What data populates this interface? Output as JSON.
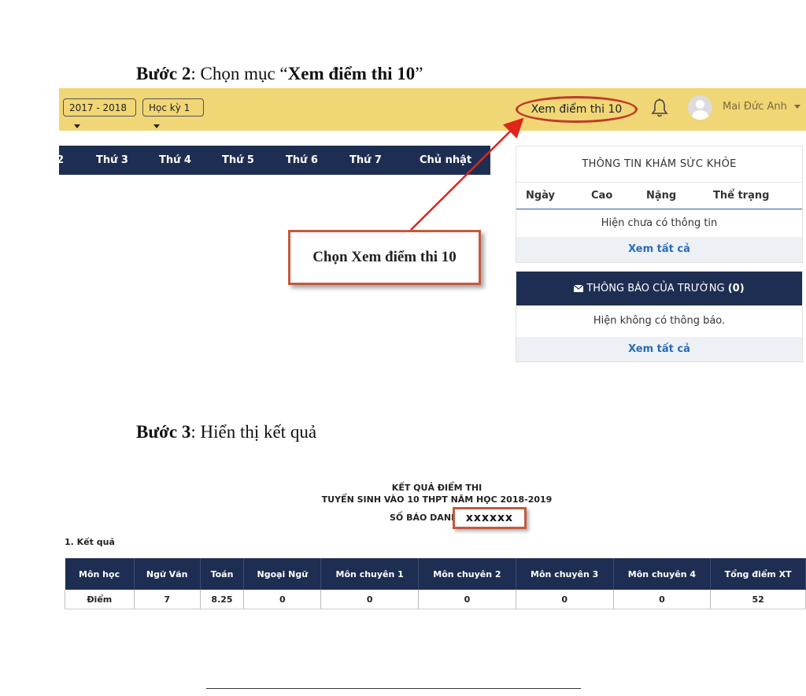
{
  "step2": {
    "prefix": "Bước 2",
    "middle": ": Chọn mục “",
    "bold": "Xem điểm thi 10",
    "suffix": "”"
  },
  "topbar": {
    "year_select": "2017 - 2018",
    "term_select": "Học kỳ 1",
    "exam_button": "Xem điểm thi 10",
    "username": "Mai Đức Anh"
  },
  "days": [
    "2",
    "Thứ 3",
    "Thứ 4",
    "Thứ 5",
    "Thứ 6",
    "Thứ 7",
    "Chủ nhật"
  ],
  "health": {
    "title": "THÔNG TIN KHÁM SỨC KHỎE",
    "columns": [
      "Ngày",
      "Cao",
      "Nặng",
      "Thể trạng"
    ],
    "empty": "Hiện chưa có thông tin",
    "more": "Xem tất cả"
  },
  "notice": {
    "title": "THÔNG BÁO CỦA TRƯỜNG",
    "count": "(0)",
    "empty": "Hiện không có thông báo.",
    "more": "Xem tất cả"
  },
  "callout": "Chọn Xem điểm thi 10",
  "step3": {
    "prefix": "Bước 3",
    "rest": ": Hiển thị kết quả"
  },
  "result": {
    "title1": "KẾT QUẢ ĐIỂM THI",
    "title2": "TUYỂN SINH VÀO 10 THPT NĂM HỌC 2018-2019",
    "sbd_label": "SỐ BÁO DANH",
    "sbd_value": "xxxxxx",
    "section": "1. Kết quả",
    "headers": [
      "Môn học",
      "Ngữ Văn",
      "Toán",
      "Ngoại Ngữ",
      "Môn chuyên 1",
      "Môn chuyên 2",
      "Môn chuyên 3",
      "Môn chuyên 4",
      "Tổng điểm XT"
    ],
    "row": [
      "Điểm",
      "7",
      "8.25",
      "0",
      "0",
      "0",
      "0",
      "0",
      "52"
    ]
  },
  "colors": {
    "accent_yellow": "#f0d675",
    "navy": "#1e2e52",
    "highlight_red": "#c0392b",
    "link_blue": "#2a6bb8"
  },
  "icons": [
    "caret-down-icon",
    "bell-icon",
    "avatar-icon",
    "envelope-icon",
    "arrow-icon"
  ]
}
